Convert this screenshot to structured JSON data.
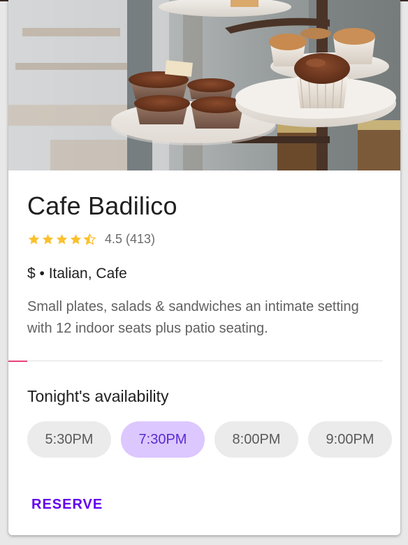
{
  "card": {
    "hero_image": "cupcakes-on-marble-stand",
    "title": "Cafe Badilico",
    "rating": {
      "stars": 4.5,
      "text": "4.5 (413)",
      "star_color": "#fbc02d"
    },
    "meta": "$ • Italian, Cafe",
    "description": "Small plates, salads & sandwiches an intimate setting with 12 indoor seats plus patio seating.",
    "availability": {
      "title": "Tonight's availability",
      "times": [
        "5:30PM",
        "7:30PM",
        "8:00PM",
        "9:00PM"
      ],
      "selected": "7:30PM"
    },
    "action": {
      "reserve_label": "RESERVE"
    }
  },
  "colors": {
    "accent": "#6200ee",
    "chip_selected_bg": "#dcc7ff",
    "chip_bg": "#ebebeb",
    "divider_accent": "#e8417a"
  }
}
